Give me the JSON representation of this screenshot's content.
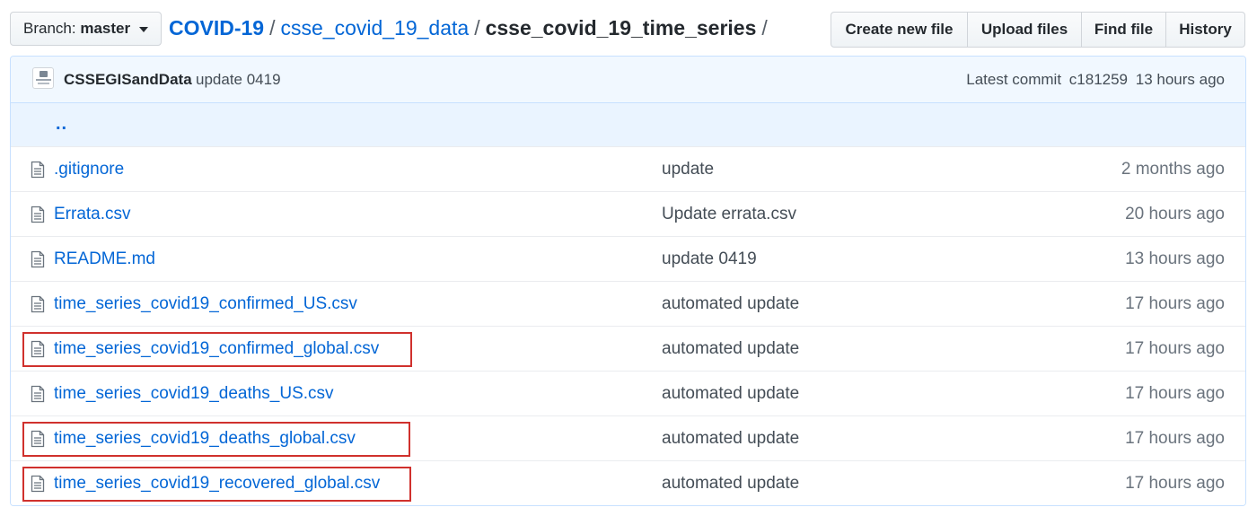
{
  "branch": {
    "prefix": "Branch:",
    "name": "master"
  },
  "breadcrumb": {
    "root": "COVID-19",
    "parts": [
      "csse_covid_19_data",
      "csse_covid_19_time_series"
    ],
    "separator": "/"
  },
  "actions": [
    "Create new file",
    "Upload files",
    "Find file",
    "History"
  ],
  "commit": {
    "author": "CSSEGISandData",
    "message": "update 0419",
    "latest_label": "Latest commit",
    "sha": "c181259",
    "age": "13 hours ago"
  },
  "parent_dir": "..",
  "files": [
    {
      "name": ".gitignore",
      "message": "update",
      "age": "2 months ago",
      "highlighted": false
    },
    {
      "name": "Errata.csv",
      "message": "Update errata.csv",
      "age": "20 hours ago",
      "highlighted": false
    },
    {
      "name": "README.md",
      "message": "update 0419",
      "age": "13 hours ago",
      "highlighted": false
    },
    {
      "name": "time_series_covid19_confirmed_US.csv",
      "message": "automated update",
      "age": "17 hours ago",
      "highlighted": false
    },
    {
      "name": "time_series_covid19_confirmed_global.csv",
      "message": "automated update",
      "age": "17 hours ago",
      "highlighted": true
    },
    {
      "name": "time_series_covid19_deaths_US.csv",
      "message": "automated update",
      "age": "17 hours ago",
      "highlighted": false
    },
    {
      "name": "time_series_covid19_deaths_global.csv",
      "message": "automated update",
      "age": "17 hours ago",
      "highlighted": true
    },
    {
      "name": "time_series_covid19_recovered_global.csv",
      "message": "automated update",
      "age": "17 hours ago",
      "highlighted": true
    }
  ],
  "colors": {
    "link": "#0366d6",
    "highlight_box": "#d0312d",
    "commit_bar": "#f1f8ff"
  },
  "icons": {
    "file": "file-text-icon",
    "caret": "caret-down-icon"
  }
}
